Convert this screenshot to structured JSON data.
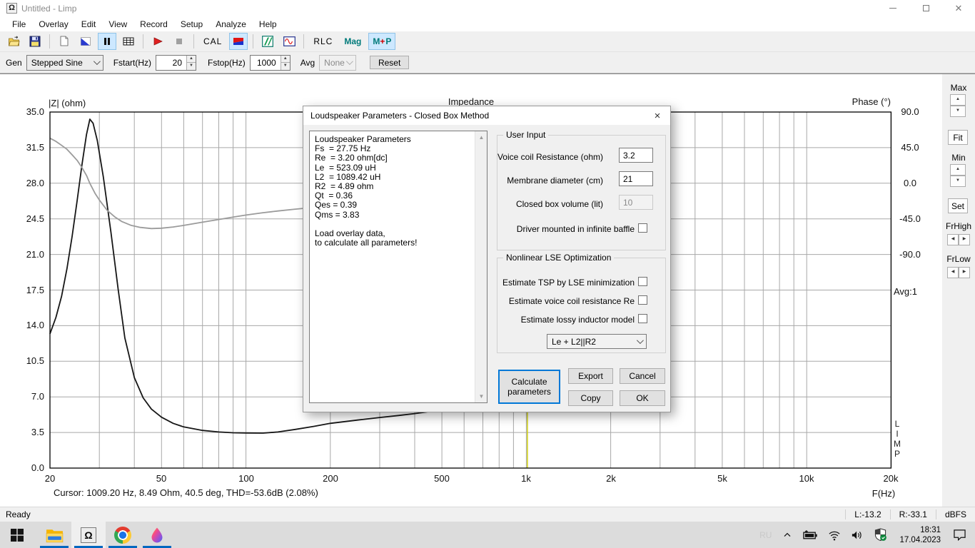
{
  "window": {
    "title": "Untitled - Limp",
    "icon": "omega",
    "controls": [
      "minimize",
      "maximize",
      "close"
    ]
  },
  "menu": {
    "items": [
      "File",
      "Overlay",
      "Edit",
      "View",
      "Record",
      "Setup",
      "Analyze",
      "Help"
    ]
  },
  "toolbar": {
    "icons": [
      "open-icon",
      "save-icon",
      "new-overlay-icon",
      "overlay-toggle-icon",
      "pause-icon",
      "table-icon",
      "play-icon",
      "stop-icon",
      "mag-phase-split-icon",
      "green-stripes-icon",
      "sine-generator-icon"
    ],
    "cal_label": "CAL",
    "rlc_label": "RLC",
    "mag_label": "Mag",
    "mp_m": "M",
    "mp_plus": "+",
    "mp_p": "P"
  },
  "controls": {
    "gen_label": "Gen",
    "gen_value": "Stepped Sine",
    "fstart_label": "Fstart(Hz)",
    "fstart_value": "20",
    "fstop_label": "Fstop(Hz)",
    "fstop_value": "1000",
    "avg_label": "Avg",
    "avg_value": "None",
    "reset_label": "Reset"
  },
  "right_panel": {
    "max_label": "Max",
    "fit_label": "Fit",
    "min_label": "Min",
    "set_label": "Set",
    "frhigh_label": "FrHigh",
    "frlow_label": "FrLow",
    "avg_indicator": "Avg:1",
    "limp_vertical": "L\nI\nM\nP"
  },
  "chart_data": {
    "type": "line",
    "title": "Impedance",
    "x_axis": {
      "label": "F(Hz)",
      "scale": "log",
      "min": 20,
      "max": 20000,
      "ticks": [
        [
          20,
          "20"
        ],
        [
          50,
          "50"
        ],
        [
          100,
          "100"
        ],
        [
          200,
          "200"
        ],
        [
          500,
          "500"
        ],
        [
          1000,
          "1k"
        ],
        [
          2000,
          "2k"
        ],
        [
          5000,
          "5k"
        ],
        [
          10000,
          "10k"
        ],
        [
          20000,
          "20k"
        ]
      ],
      "grid_freqs": [
        20,
        30,
        40,
        50,
        60,
        70,
        80,
        90,
        100,
        200,
        300,
        400,
        500,
        600,
        700,
        800,
        900,
        1000,
        2000,
        3000,
        4000,
        5000,
        6000,
        7000,
        8000,
        9000,
        10000,
        20000
      ]
    },
    "y_left": {
      "label": "|Z| (ohm)",
      "min": 0,
      "max": 35,
      "step": 3.5,
      "tick_labels": [
        "35.0",
        "31.5",
        "28.0",
        "24.5",
        "21.0",
        "17.5",
        "14.0",
        "10.5",
        "7.0",
        "3.5",
        "0.0"
      ]
    },
    "y_right": {
      "label": "Phase (°)",
      "ticks": [
        [
          90,
          "90.0"
        ],
        [
          45,
          "45.0"
        ],
        [
          0,
          "0.0"
        ],
        [
          -45,
          "-45.0"
        ],
        [
          -90,
          "-90.0"
        ]
      ]
    },
    "grid": true,
    "series": [
      {
        "name": "impedance_magnitude",
        "axis": "left",
        "color": "#161616",
        "points": [
          [
            20,
            13.2
          ],
          [
            21,
            14.8
          ],
          [
            22,
            16.9
          ],
          [
            23,
            19.6
          ],
          [
            24,
            22.8
          ],
          [
            25,
            26.3
          ],
          [
            26,
            29.8
          ],
          [
            27,
            32.8
          ],
          [
            27.75,
            34.3
          ],
          [
            28.5,
            33.9
          ],
          [
            29.5,
            32.2
          ],
          [
            31,
            28.6
          ],
          [
            33,
            23.2
          ],
          [
            35,
            17.6
          ],
          [
            37,
            12.8
          ],
          [
            40,
            8.9
          ],
          [
            43,
            6.9
          ],
          [
            46,
            5.8
          ],
          [
            50,
            5.0
          ],
          [
            55,
            4.4
          ],
          [
            60,
            4.05
          ],
          [
            70,
            3.7
          ],
          [
            80,
            3.55
          ],
          [
            90,
            3.47
          ],
          [
            100,
            3.45
          ],
          [
            115,
            3.44
          ],
          [
            130,
            3.55
          ],
          [
            150,
            3.8
          ],
          [
            175,
            4.1
          ],
          [
            200,
            4.4
          ],
          [
            250,
            4.72
          ],
          [
            300,
            4.97
          ],
          [
            350,
            5.17
          ],
          [
            400,
            5.36
          ],
          [
            450,
            5.55
          ],
          [
            500,
            5.8
          ],
          [
            600,
            6.3
          ],
          [
            700,
            6.8
          ],
          [
            800,
            7.4
          ],
          [
            900,
            7.95
          ],
          [
            1009.2,
            8.49
          ]
        ]
      },
      {
        "name": "impedance_phase",
        "axis": "right",
        "color": "#9b9b9b",
        "points": [
          [
            20,
            57
          ],
          [
            21,
            53
          ],
          [
            22,
            48
          ],
          [
            23,
            43
          ],
          [
            24,
            36
          ],
          [
            25,
            29
          ],
          [
            26,
            20
          ],
          [
            27,
            10
          ],
          [
            27.75,
            0
          ],
          [
            29,
            -13
          ],
          [
            30,
            -21
          ],
          [
            32,
            -34
          ],
          [
            34,
            -42
          ],
          [
            36,
            -48
          ],
          [
            39,
            -53
          ],
          [
            42,
            -55.5
          ],
          [
            46,
            -57
          ],
          [
            50,
            -56.5
          ],
          [
            55,
            -55
          ],
          [
            60,
            -53
          ],
          [
            70,
            -49
          ],
          [
            80,
            -45.5
          ],
          [
            90,
            -42.5
          ],
          [
            100,
            -40
          ],
          [
            115,
            -37
          ],
          [
            130,
            -34.8
          ],
          [
            150,
            -32.5
          ],
          [
            170,
            -30.7
          ],
          [
            200,
            -28
          ],
          [
            250,
            -24
          ],
          [
            300,
            -20.5
          ],
          [
            400,
            -14
          ],
          [
            500,
            -8
          ],
          [
            600,
            -2.5
          ],
          [
            700,
            4
          ],
          [
            800,
            12
          ],
          [
            900,
            24
          ],
          [
            1009.2,
            40.5
          ]
        ]
      }
    ],
    "cursor": {
      "freq": 1009.2,
      "color": "#cccc00",
      "readout": "Cursor: 1009.20 Hz, 8.49 Ohm, 40.5 deg, THD=-53.6dB (2.08%)"
    }
  },
  "dialog": {
    "title": "Loudspeaker Parameters - Closed Box Method",
    "results": [
      "Loudspeaker Parameters",
      "Fs  = 27.75 Hz",
      "Re  = 3.20 ohm[dc]",
      "Le  = 523.09 uH",
      "L2  = 1089.42 uH",
      "R2  = 4.89 ohm",
      "Qt  = 0.36",
      "Qes = 0.39",
      "Qms = 3.83",
      "",
      "Load overlay data,",
      "to calculate all parameters!"
    ],
    "user_input": {
      "legend": "User Input",
      "fields": [
        {
          "label": "Voice coil Resistance (ohm)",
          "value": "3.2"
        },
        {
          "label": "Membrane diameter (cm)",
          "value": "21"
        },
        {
          "label": "Closed box volume (lit)",
          "value": "10"
        }
      ],
      "baffle_checkbox_label": "Driver mounted in infinite baffle"
    },
    "lse": {
      "legend": "Nonlinear LSE Optimization",
      "checkboxes": [
        "Estimate TSP by LSE minimization",
        "Estimate voice coil resistance Re",
        "Estimate lossy inductor model"
      ],
      "model_value": "Le + L2||R2"
    },
    "buttons": {
      "calculate": "Calculate parameters",
      "export": "Export",
      "cancel": "Cancel",
      "copy": "Copy",
      "ok": "OK"
    }
  },
  "status_bar": {
    "ready": "Ready",
    "left_level": "L:-13.2",
    "right_level": "R:-33.1",
    "unit": "dBFS"
  },
  "taskbar": {
    "icons": [
      "start-icon",
      "file-explorer-icon",
      "limp-omega-icon",
      "chrome-icon",
      "paint3d-icon"
    ],
    "tray_icons": [
      "language-indicator",
      "chevron-up-icon",
      "battery-icon",
      "wifi-icon",
      "speaker-icon",
      "defender-shield-icon",
      "clock",
      "action-center-icon"
    ],
    "language": "RU",
    "time": "18:31",
    "date": "17.04.2023"
  }
}
